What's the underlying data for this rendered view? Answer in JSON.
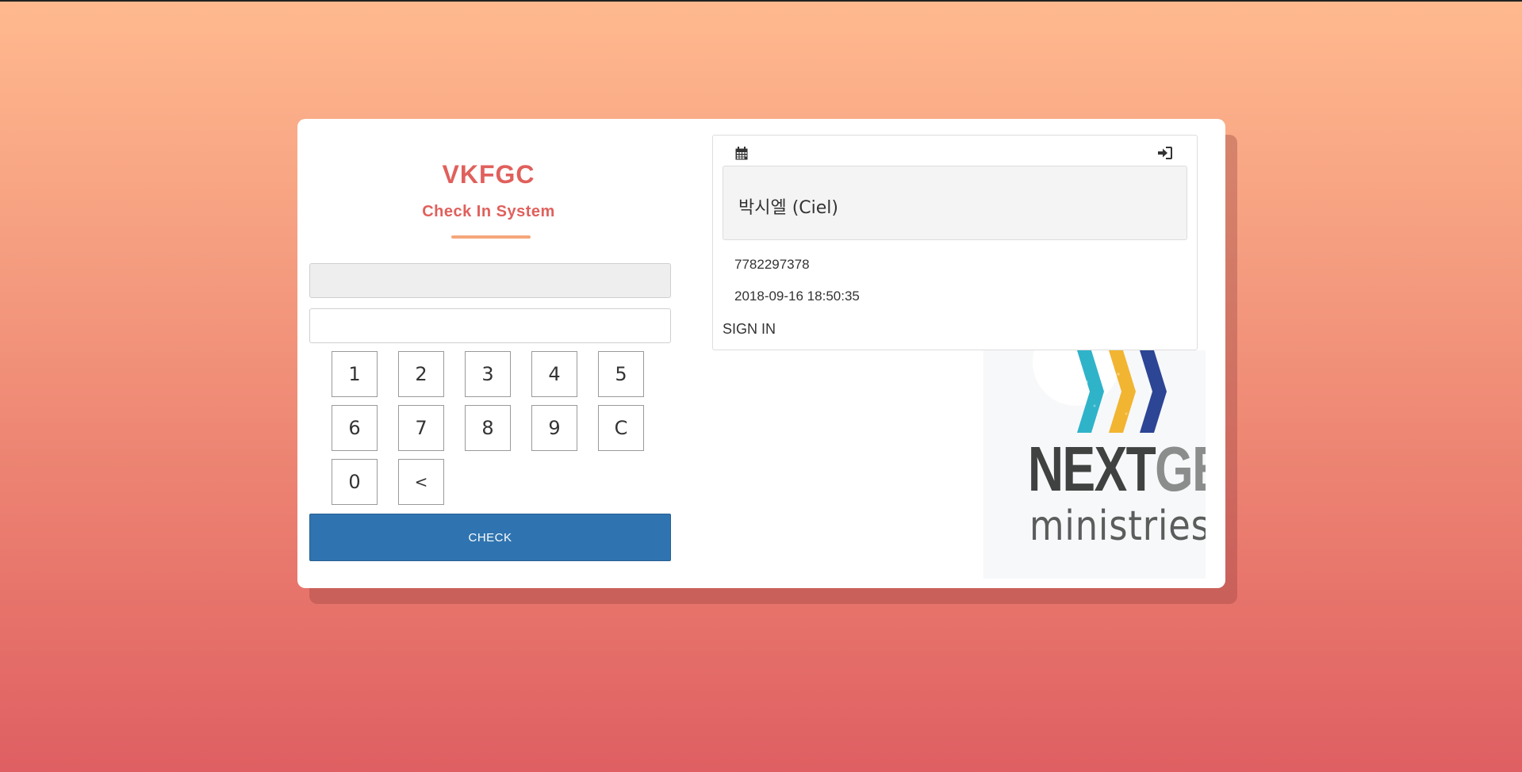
{
  "header": {
    "title": "VKFGC",
    "subtitle": "Check In System"
  },
  "form": {
    "readonly_value": "",
    "pin_value": ""
  },
  "keypad": {
    "keys": [
      "1",
      "2",
      "3",
      "4",
      "5",
      "6",
      "7",
      "8",
      "9",
      "C",
      "0",
      "<"
    ]
  },
  "check_button": {
    "label": "CHECK"
  },
  "record": {
    "name": "박시엘 (Ciel)",
    "phone": "7782297378",
    "timestamp": "2018-09-16 18:50:35",
    "status": "SIGN IN",
    "left_icon": "calendar-icon",
    "right_icon": "sign-in-icon"
  },
  "logo": {
    "line1_a": "NEXT",
    "line1_b": "GEN",
    "line2": "ministries",
    "colors": [
      "#2fb3c9",
      "#f2b531",
      "#2c4594"
    ]
  },
  "colors": {
    "accent": "#e0605c",
    "button": "#2f74b0",
    "divider": "#f5a67a"
  }
}
